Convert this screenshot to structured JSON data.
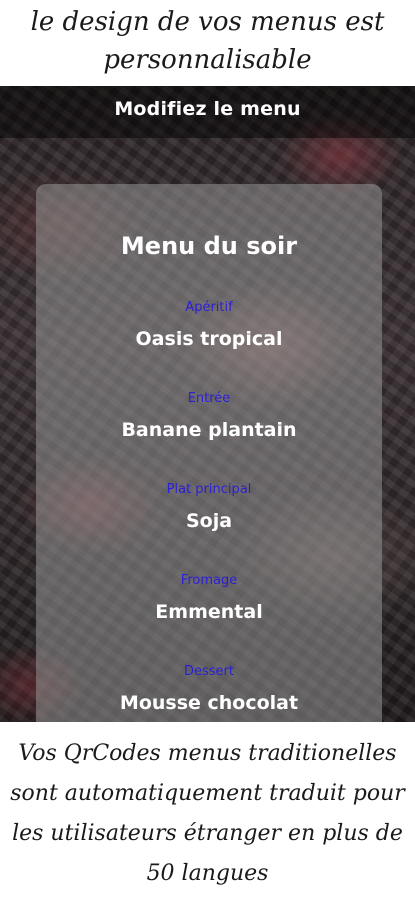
{
  "top_caption": "le design de vos menus est personnalisable",
  "header": {
    "title": "Modifiez le menu"
  },
  "menu": {
    "title": "Menu du soir",
    "courses": [
      {
        "label": "Apéritif",
        "dish": "Oasis tropical"
      },
      {
        "label": "Entrée",
        "dish": "Banane plantain"
      },
      {
        "label": "Plat principal",
        "dish": "Soja"
      },
      {
        "label": "Fromage",
        "dish": "Emmental"
      },
      {
        "label": "Dessert",
        "dish": "Mousse chocolat"
      }
    ]
  },
  "bottom_caption": "Vos QrCodes menus traditionelles sont automatiquement traduit pour les utilisateurs étranger en plus de 50 langues",
  "colors": {
    "course_label": "#2b1fd6",
    "dish_text": "#ffffff",
    "card_overlay": "rgba(150,150,150,0.55)"
  }
}
